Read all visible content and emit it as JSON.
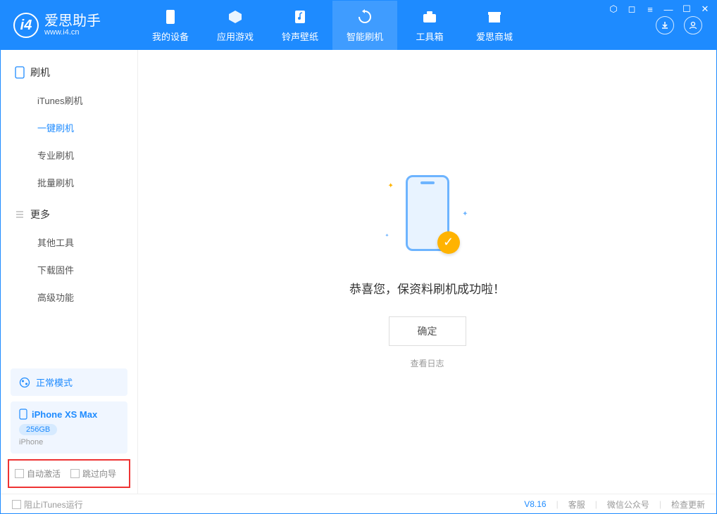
{
  "app": {
    "name": "爱思助手",
    "url": "www.i4.cn"
  },
  "nav": [
    {
      "label": "我的设备"
    },
    {
      "label": "应用游戏"
    },
    {
      "label": "铃声壁纸"
    },
    {
      "label": "智能刷机"
    },
    {
      "label": "工具箱"
    },
    {
      "label": "爱思商城"
    }
  ],
  "sidebar": {
    "section1": {
      "title": "刷机",
      "items": [
        "iTunes刷机",
        "一键刷机",
        "专业刷机",
        "批量刷机"
      ]
    },
    "section2": {
      "title": "更多",
      "items": [
        "其他工具",
        "下载固件",
        "高级功能"
      ]
    }
  },
  "mode": {
    "label": "正常模式"
  },
  "device": {
    "name": "iPhone XS Max",
    "storage": "256GB",
    "type": "iPhone"
  },
  "options": {
    "auto_activate": "自动激活",
    "skip_guide": "跳过向导"
  },
  "main": {
    "success_text": "恭喜您，保资料刷机成功啦！",
    "ok_button": "确定",
    "view_log": "查看日志"
  },
  "footer": {
    "block_itunes": "阻止iTunes运行",
    "version": "V8.16",
    "support": "客服",
    "wechat": "微信公众号",
    "update": "检查更新"
  }
}
